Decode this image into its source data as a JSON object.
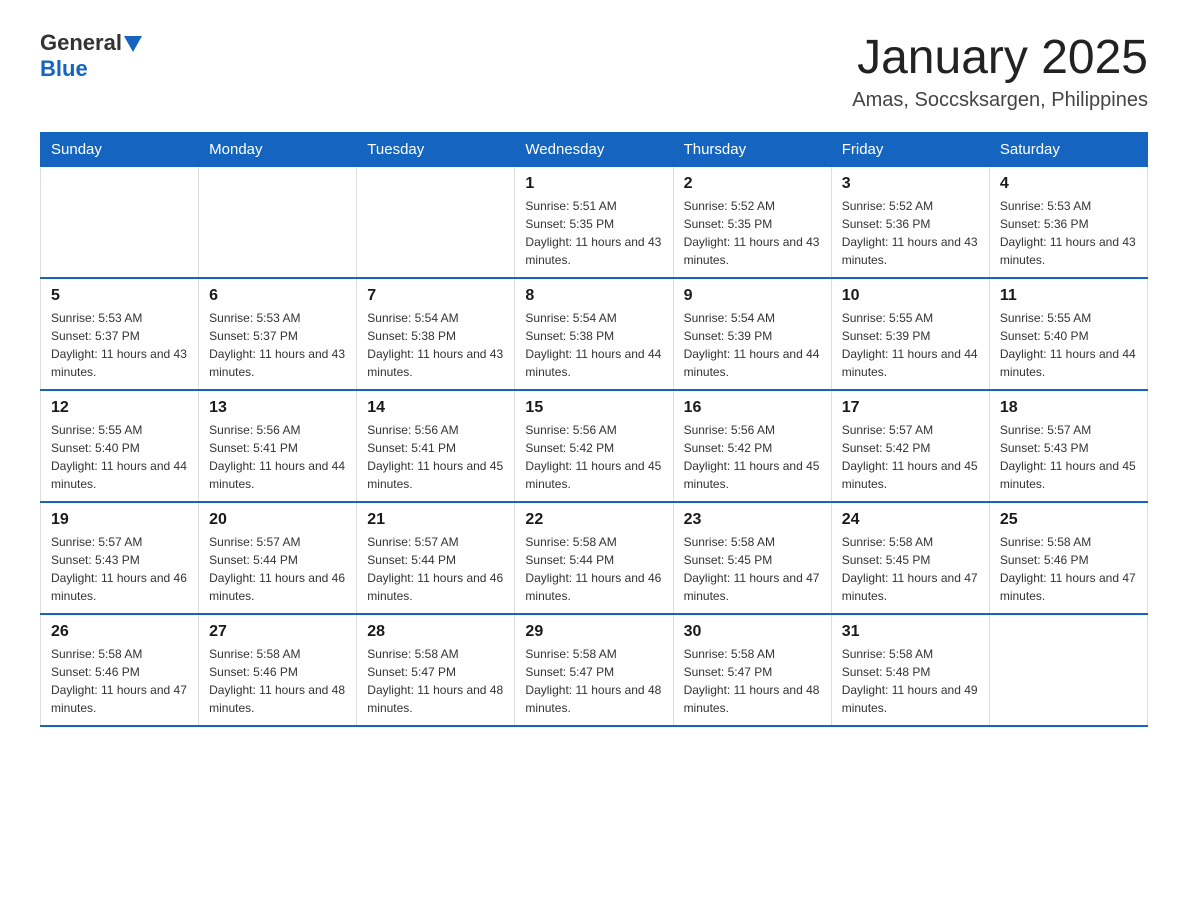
{
  "header": {
    "logo_general": "General",
    "logo_blue": "Blue",
    "title": "January 2025",
    "subtitle": "Amas, Soccsksargen, Philippines"
  },
  "days_of_week": [
    "Sunday",
    "Monday",
    "Tuesday",
    "Wednesday",
    "Thursday",
    "Friday",
    "Saturday"
  ],
  "weeks": [
    [
      {
        "day": "",
        "info": ""
      },
      {
        "day": "",
        "info": ""
      },
      {
        "day": "",
        "info": ""
      },
      {
        "day": "1",
        "info": "Sunrise: 5:51 AM\nSunset: 5:35 PM\nDaylight: 11 hours and 43 minutes."
      },
      {
        "day": "2",
        "info": "Sunrise: 5:52 AM\nSunset: 5:35 PM\nDaylight: 11 hours and 43 minutes."
      },
      {
        "day": "3",
        "info": "Sunrise: 5:52 AM\nSunset: 5:36 PM\nDaylight: 11 hours and 43 minutes."
      },
      {
        "day": "4",
        "info": "Sunrise: 5:53 AM\nSunset: 5:36 PM\nDaylight: 11 hours and 43 minutes."
      }
    ],
    [
      {
        "day": "5",
        "info": "Sunrise: 5:53 AM\nSunset: 5:37 PM\nDaylight: 11 hours and 43 minutes."
      },
      {
        "day": "6",
        "info": "Sunrise: 5:53 AM\nSunset: 5:37 PM\nDaylight: 11 hours and 43 minutes."
      },
      {
        "day": "7",
        "info": "Sunrise: 5:54 AM\nSunset: 5:38 PM\nDaylight: 11 hours and 43 minutes."
      },
      {
        "day": "8",
        "info": "Sunrise: 5:54 AM\nSunset: 5:38 PM\nDaylight: 11 hours and 44 minutes."
      },
      {
        "day": "9",
        "info": "Sunrise: 5:54 AM\nSunset: 5:39 PM\nDaylight: 11 hours and 44 minutes."
      },
      {
        "day": "10",
        "info": "Sunrise: 5:55 AM\nSunset: 5:39 PM\nDaylight: 11 hours and 44 minutes."
      },
      {
        "day": "11",
        "info": "Sunrise: 5:55 AM\nSunset: 5:40 PM\nDaylight: 11 hours and 44 minutes."
      }
    ],
    [
      {
        "day": "12",
        "info": "Sunrise: 5:55 AM\nSunset: 5:40 PM\nDaylight: 11 hours and 44 minutes."
      },
      {
        "day": "13",
        "info": "Sunrise: 5:56 AM\nSunset: 5:41 PM\nDaylight: 11 hours and 44 minutes."
      },
      {
        "day": "14",
        "info": "Sunrise: 5:56 AM\nSunset: 5:41 PM\nDaylight: 11 hours and 45 minutes."
      },
      {
        "day": "15",
        "info": "Sunrise: 5:56 AM\nSunset: 5:42 PM\nDaylight: 11 hours and 45 minutes."
      },
      {
        "day": "16",
        "info": "Sunrise: 5:56 AM\nSunset: 5:42 PM\nDaylight: 11 hours and 45 minutes."
      },
      {
        "day": "17",
        "info": "Sunrise: 5:57 AM\nSunset: 5:42 PM\nDaylight: 11 hours and 45 minutes."
      },
      {
        "day": "18",
        "info": "Sunrise: 5:57 AM\nSunset: 5:43 PM\nDaylight: 11 hours and 45 minutes."
      }
    ],
    [
      {
        "day": "19",
        "info": "Sunrise: 5:57 AM\nSunset: 5:43 PM\nDaylight: 11 hours and 46 minutes."
      },
      {
        "day": "20",
        "info": "Sunrise: 5:57 AM\nSunset: 5:44 PM\nDaylight: 11 hours and 46 minutes."
      },
      {
        "day": "21",
        "info": "Sunrise: 5:57 AM\nSunset: 5:44 PM\nDaylight: 11 hours and 46 minutes."
      },
      {
        "day": "22",
        "info": "Sunrise: 5:58 AM\nSunset: 5:44 PM\nDaylight: 11 hours and 46 minutes."
      },
      {
        "day": "23",
        "info": "Sunrise: 5:58 AM\nSunset: 5:45 PM\nDaylight: 11 hours and 47 minutes."
      },
      {
        "day": "24",
        "info": "Sunrise: 5:58 AM\nSunset: 5:45 PM\nDaylight: 11 hours and 47 minutes."
      },
      {
        "day": "25",
        "info": "Sunrise: 5:58 AM\nSunset: 5:46 PM\nDaylight: 11 hours and 47 minutes."
      }
    ],
    [
      {
        "day": "26",
        "info": "Sunrise: 5:58 AM\nSunset: 5:46 PM\nDaylight: 11 hours and 47 minutes."
      },
      {
        "day": "27",
        "info": "Sunrise: 5:58 AM\nSunset: 5:46 PM\nDaylight: 11 hours and 48 minutes."
      },
      {
        "day": "28",
        "info": "Sunrise: 5:58 AM\nSunset: 5:47 PM\nDaylight: 11 hours and 48 minutes."
      },
      {
        "day": "29",
        "info": "Sunrise: 5:58 AM\nSunset: 5:47 PM\nDaylight: 11 hours and 48 minutes."
      },
      {
        "day": "30",
        "info": "Sunrise: 5:58 AM\nSunset: 5:47 PM\nDaylight: 11 hours and 48 minutes."
      },
      {
        "day": "31",
        "info": "Sunrise: 5:58 AM\nSunset: 5:48 PM\nDaylight: 11 hours and 49 minutes."
      },
      {
        "day": "",
        "info": ""
      }
    ]
  ]
}
